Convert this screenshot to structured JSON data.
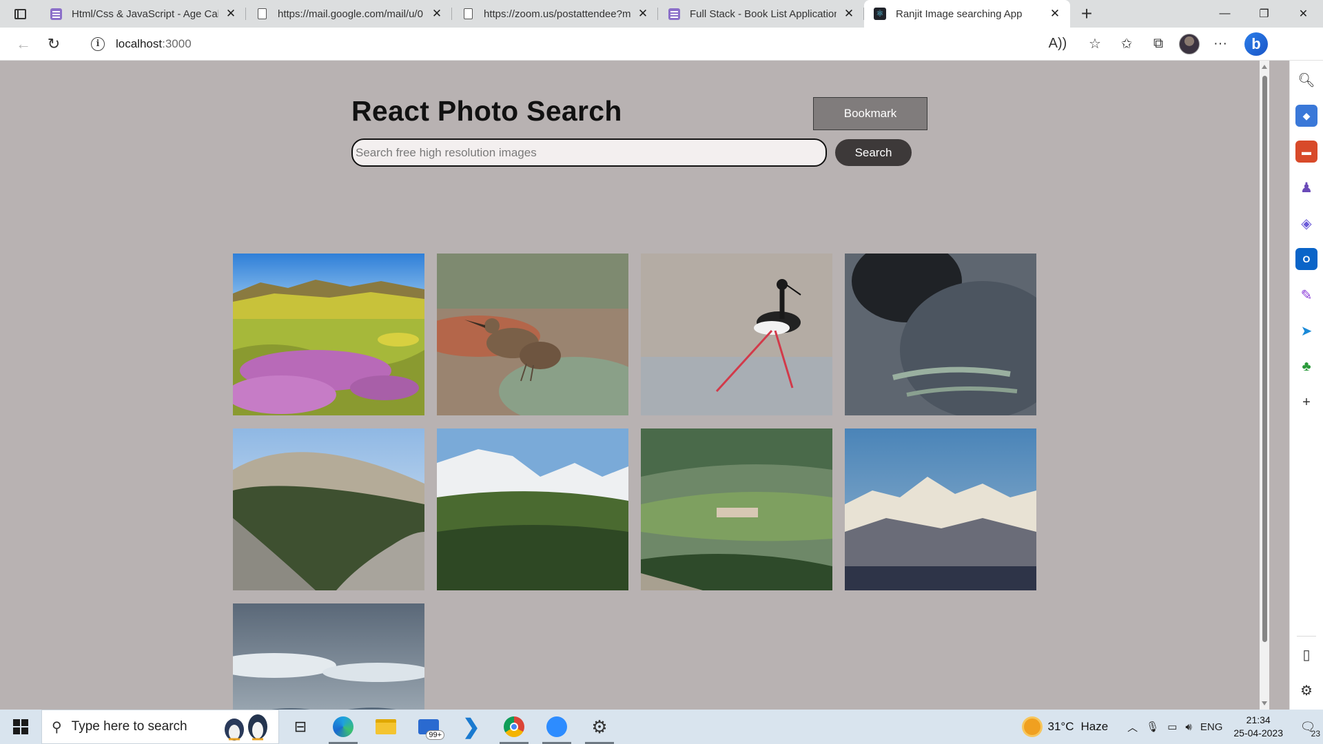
{
  "browser": {
    "tabs": [
      {
        "title": "Html/Css & JavaScript - Age Calc",
        "favicon": "list-icon",
        "active": false
      },
      {
        "title": "https://mail.google.com/mail/u/0",
        "favicon": "document-icon",
        "active": false
      },
      {
        "title": "https://zoom.us/postattendee?m",
        "favicon": "document-icon",
        "active": false
      },
      {
        "title": "Full Stack - Book List Application",
        "favicon": "list-icon",
        "active": false
      },
      {
        "title": "Ranjit Image searching App",
        "favicon": "react-icon",
        "active": true
      }
    ],
    "url_host": "localhost",
    "url_port": ":3000"
  },
  "app": {
    "title": "React Photo Search",
    "bookmark_label": "Bookmark",
    "search_placeholder": "Search free high resolution images",
    "search_value": "",
    "search_button_label": "Search",
    "background_color": "#b8b2b2",
    "photos": [
      {
        "subject": "wildflower-meadow-hills"
      },
      {
        "subject": "thrasher-bird-on-ground"
      },
      {
        "subject": "black-necked-stilt-in-water"
      },
      {
        "subject": "dark-animal-closeup"
      },
      {
        "subject": "gravel-mountain-road"
      },
      {
        "subject": "snowy-mountain-forest"
      },
      {
        "subject": "green-valley-village"
      },
      {
        "subject": "snow-capped-mountain-range"
      },
      {
        "subject": "cloudy-mountain-sky"
      }
    ]
  },
  "taskbar": {
    "search_placeholder": "Type here to search",
    "mail_badge": "99+",
    "weather_temp": "31°C",
    "weather_desc": "Haze",
    "language": "ENG",
    "time": "21:34",
    "date": "25-04-2023",
    "notification_count": "23"
  }
}
